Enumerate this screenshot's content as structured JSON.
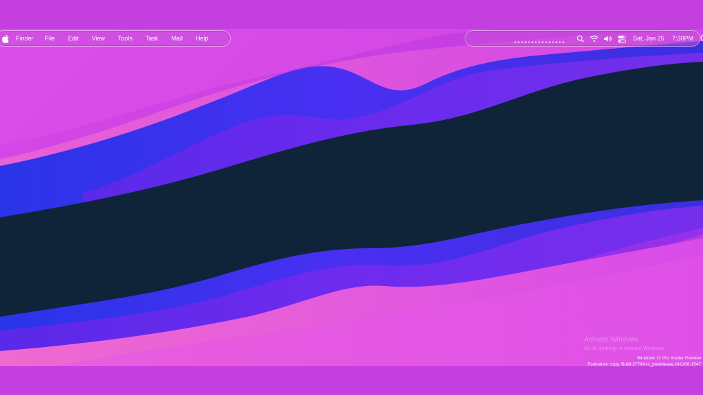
{
  "menubar": {
    "apple_icon": "apple-logo-icon",
    "items": [
      {
        "label": "Finder"
      },
      {
        "label": "File"
      },
      {
        "label": "Edit"
      },
      {
        "label": "View"
      },
      {
        "label": "Tools"
      },
      {
        "label": "Task"
      },
      {
        "label": "Mail"
      },
      {
        "label": "Help"
      }
    ]
  },
  "status_bar": {
    "icons": [
      "search-icon",
      "wifi-icon",
      "volume-icon",
      "control-center-icon"
    ],
    "date": "Sat, Jan 25",
    "time": "7:30PM"
  },
  "watermark": {
    "title": "Activate Windows",
    "subtitle": "Go to Settings to activate Windows."
  },
  "build_info": {
    "line1": "Windows 11 Pro Insider Preview",
    "line2": "Evaluation copy. Build 27764.rs_prerelease.241206-1547"
  },
  "colors": {
    "background": "#c53ee0",
    "dark_band": "#0f2438",
    "blue": "#3a2ff0",
    "violet": "#7b2cf0",
    "pink": "#ee5ad8"
  }
}
